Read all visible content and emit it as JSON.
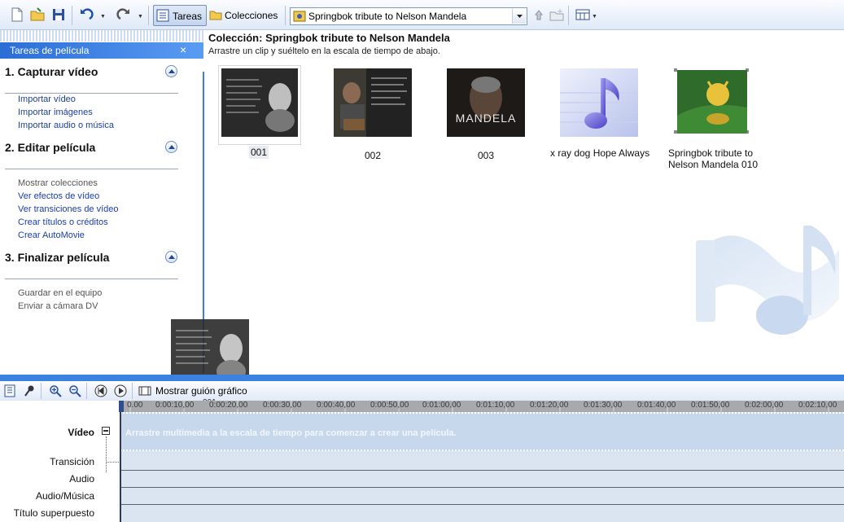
{
  "toolbar": {
    "tareas_label": "Tareas",
    "colecciones_label": "Colecciones",
    "collection_selected": "Springbok tribute to Nelson Mandela"
  },
  "sidebar": {
    "header": "Tareas de película",
    "sections": [
      {
        "title": "1. Capturar vídeo",
        "items": [
          "Importar vídeo",
          "Importar imágenes",
          "Importar audio o música"
        ]
      },
      {
        "title": "2. Editar película",
        "items": [
          "Mostrar colecciones",
          "Ver efectos de vídeo",
          "Ver transiciones de vídeo",
          "Crear títulos o créditos",
          "Crear AutoMovie"
        ]
      },
      {
        "title": "3. Finalizar película",
        "items": [
          "Guardar en el equipo",
          "Enviar a cámara DV"
        ]
      }
    ]
  },
  "content": {
    "title": "Colección: Springbok tribute to Nelson Mandela",
    "subtitle": "Arrastre un clip y suéltelo en la escala de tiempo de abajo.",
    "clips": [
      {
        "label": "001"
      },
      {
        "label": "002"
      },
      {
        "label": "003"
      },
      {
        "label": "x ray dog Hope Always"
      },
      {
        "label": "Springbok tribute to Nelson Mandela 010"
      }
    ]
  },
  "drag_ghost_label": "001",
  "timeline": {
    "toggle_label": "Mostrar guión gráfico",
    "ruler_ticks": [
      "0.00",
      "0:00:10,00",
      "0:00:20,00",
      "0:00:30,00",
      "0:00:40,00",
      "0:00:50,00",
      "0:01:00,00",
      "0:01:10,00",
      "0:01:20,00",
      "0:01:30,00",
      "0:01:40,00",
      "0:01:50,00",
      "0:02:00,00",
      "0:02:10,00"
    ],
    "tracks": [
      "Vídeo",
      "Transición",
      "Audio",
      "Audio/Música",
      "Título superpuesto"
    ],
    "video_hint": "Arrastre multimedia a la escala de tiempo para comenzar a crear una película."
  },
  "colors": {
    "accent": "#3a82e0",
    "link": "#1a3ea8"
  }
}
